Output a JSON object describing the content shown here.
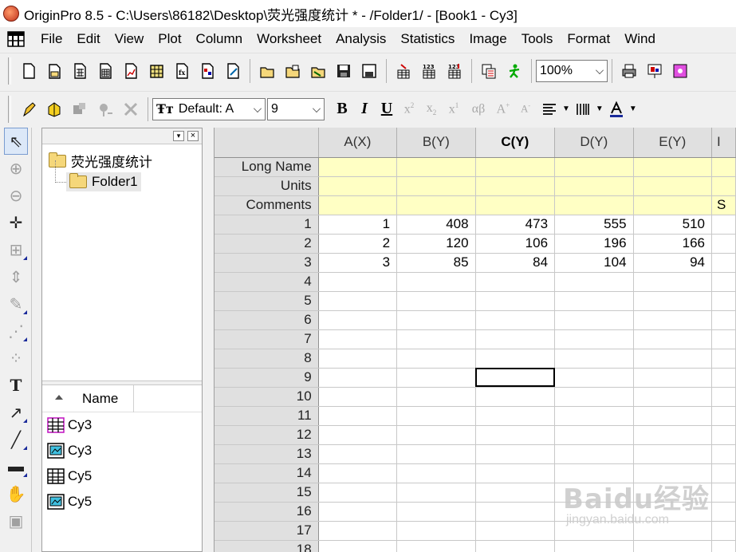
{
  "titlebar": {
    "title": "OriginPro 8.5 - C:\\Users\\86182\\Desktop\\荧光强度统计 * - /Folder1/ - [Book1 - Cy3]"
  },
  "menu": [
    "File",
    "Edit",
    "View",
    "Plot",
    "Column",
    "Worksheet",
    "Analysis",
    "Statistics",
    "Image",
    "Tools",
    "Format",
    "Wind"
  ],
  "toolbar": {
    "zoom_value": "100%",
    "font_name": "Default: A",
    "font_size": "9",
    "bold": "B",
    "italic": "I",
    "underline": "U",
    "greek": "αβ"
  },
  "explorer": {
    "root_folder": "荧光强度统计",
    "child_folder": "Folder1",
    "list_header": "Name",
    "items": [
      {
        "name": "Cy3",
        "type": "workbook"
      },
      {
        "name": "Cy3",
        "type": "graph"
      },
      {
        "name": "Cy5",
        "type": "workbook"
      },
      {
        "name": "Cy5",
        "type": "graph"
      }
    ]
  },
  "worksheet": {
    "columns": [
      "A(X)",
      "B(Y)",
      "C(Y)",
      "D(Y)",
      "E(Y)",
      "I"
    ],
    "active_column": "C(Y)",
    "label_rows": [
      "Long Name",
      "Units",
      "Comments"
    ],
    "comments_overflow": "S",
    "rows": [
      {
        "n": "1",
        "A": "1",
        "B": "408",
        "C": "473",
        "D": "555",
        "E": "510"
      },
      {
        "n": "2",
        "A": "2",
        "B": "120",
        "C": "106",
        "D": "196",
        "E": "166"
      },
      {
        "n": "3",
        "A": "3",
        "B": "85",
        "C": "84",
        "D": "104",
        "E": "94"
      },
      {
        "n": "4"
      },
      {
        "n": "5"
      },
      {
        "n": "6"
      },
      {
        "n": "7"
      },
      {
        "n": "8"
      },
      {
        "n": "9"
      },
      {
        "n": "10"
      },
      {
        "n": "11"
      },
      {
        "n": "12"
      },
      {
        "n": "13"
      },
      {
        "n": "14"
      },
      {
        "n": "15"
      },
      {
        "n": "16"
      },
      {
        "n": "17"
      },
      {
        "n": "18"
      }
    ]
  },
  "watermark": {
    "main": "Baidu经验",
    "sub": "jingyan.baidu.com"
  }
}
